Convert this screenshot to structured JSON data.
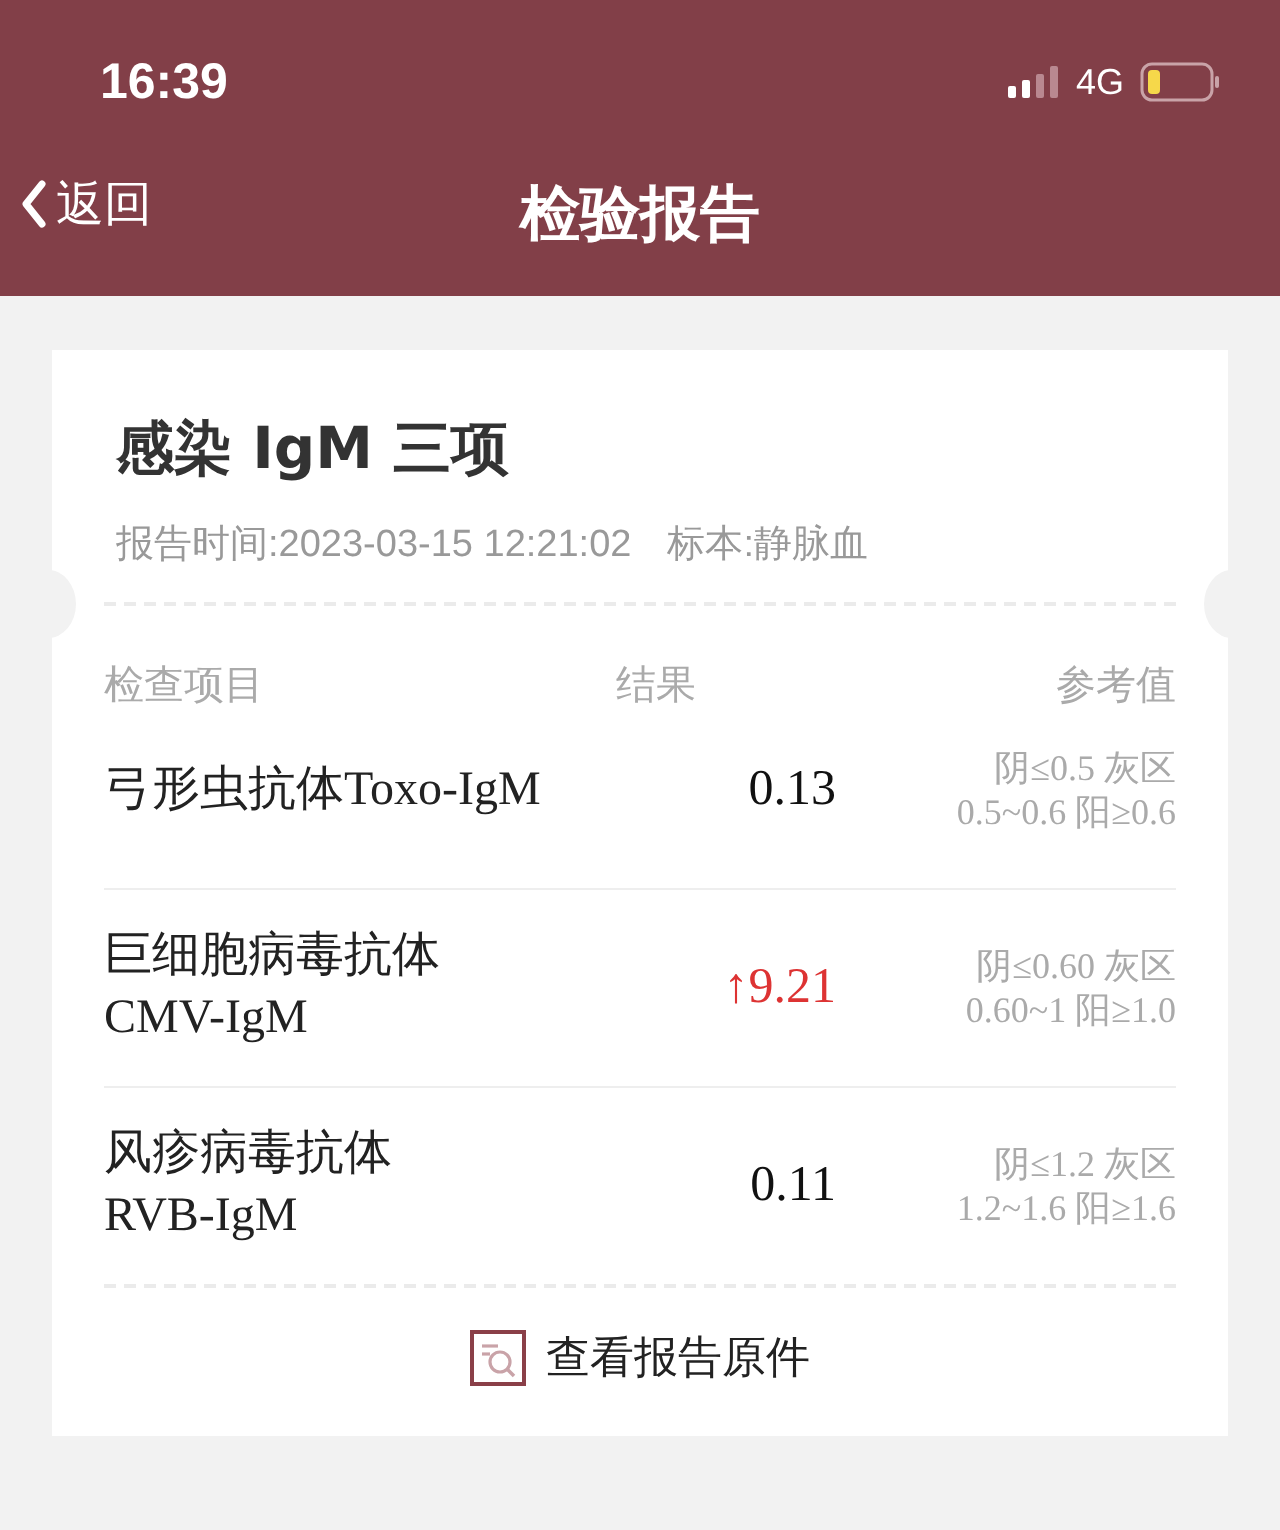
{
  "status_bar": {
    "time": "16:39",
    "network": "4G"
  },
  "nav": {
    "back": "返回",
    "title": "检验报告"
  },
  "report": {
    "title": "感染 IgM 三项",
    "report_time": "报告时间:2023-03-15 12:21:02",
    "specimen": "标本:静脉血"
  },
  "table": {
    "columns": [
      "检查项目",
      "结果",
      "参考值"
    ],
    "rows": [
      {
        "name_lines": [
          "弓形虫抗体Toxo-IgM"
        ],
        "result": "0.13",
        "abnormal": false,
        "reference": [
          "阴≤0.5 灰区",
          "0.5~0.6 阳≥0.6"
        ]
      },
      {
        "name_lines": [
          "巨细胞病毒抗体",
          "CMV-IgM"
        ],
        "result": "↑9.21",
        "abnormal": true,
        "reference": [
          "阴≤0.60 灰区",
          "0.60~1 阳≥1.0"
        ]
      },
      {
        "name_lines": [
          "风疹病毒抗体",
          "RVB-IgM"
        ],
        "result": "0.11",
        "abnormal": false,
        "reference": [
          "阴≤1.2 灰区",
          "1.2~1.6 阳≥1.6"
        ]
      }
    ]
  },
  "view_original": "查看报告原件"
}
